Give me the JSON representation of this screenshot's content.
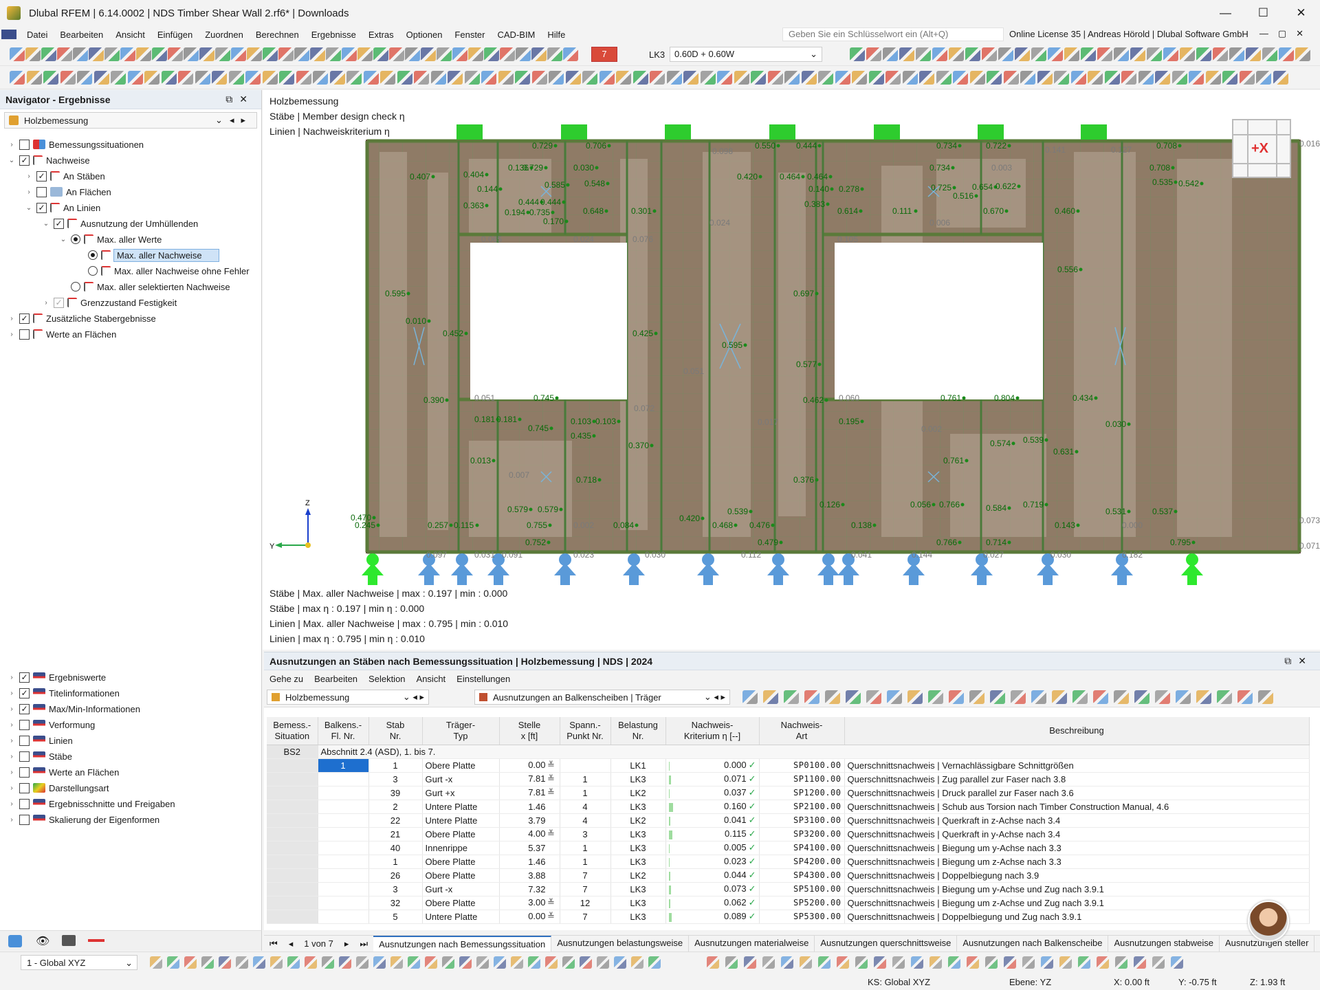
{
  "window": {
    "title": "Dlubal RFEM | 6.14.0002 | NDS Timber Shear Wall 2.rf6* | Downloads",
    "controls": [
      "—",
      "☐",
      "✕"
    ]
  },
  "menu": {
    "items": [
      "Datei",
      "Bearbeiten",
      "Ansicht",
      "Einfügen",
      "Zuordnen",
      "Berechnen",
      "Ergebnisse",
      "Extras",
      "Optionen",
      "Fenster",
      "CAD-BIM",
      "Hilfe"
    ],
    "search_placeholder": "Geben Sie ein Schlüsselwort ein (Alt+Q)",
    "license": "Online License 35 | Andreas Hörold | Dlubal Software GmbH"
  },
  "toolbar": {
    "lc_number": "7",
    "lc_name": "LK3",
    "lc_combo": "0.60D + 0.60W"
  },
  "navigator": {
    "title": "Navigator - Ergebnisse",
    "combo": "Holzbemessung",
    "tree": [
      {
        "label": "Bemessungssituationen",
        "level": 0,
        "exp": ">",
        "check": "empty"
      },
      {
        "label": "Nachweise",
        "level": 0,
        "exp": "v",
        "check": "checked"
      },
      {
        "label": "An Stäben",
        "level": 1,
        "exp": ">",
        "check": "checked"
      },
      {
        "label": "An Flächen",
        "level": 1,
        "exp": ">",
        "check": "empty"
      },
      {
        "label": "An Linien",
        "level": 1,
        "exp": "v",
        "check": "checked"
      },
      {
        "label": "Ausnutzung der Umhüllenden",
        "level": 2,
        "exp": "v",
        "check": "checked"
      },
      {
        "label": "Max. aller Werte",
        "level": 3,
        "exp": "v",
        "check": "radio-on"
      },
      {
        "label": "Max. aller Nachweise",
        "level": 4,
        "exp": "",
        "check": "radio-on",
        "selected": true
      },
      {
        "label": "Max. aller Nachweise ohne Fehler",
        "level": 4,
        "exp": "",
        "check": "radio"
      },
      {
        "label": "Max. aller selektierten Nachweise",
        "level": 3,
        "exp": "",
        "check": "radio"
      },
      {
        "label": "Grenzzustand Festigkeit",
        "level": 2,
        "exp": ">",
        "check": "grey"
      },
      {
        "label": "Zusätzliche Stabergebnisse",
        "level": 0,
        "exp": ">",
        "check": "checked"
      },
      {
        "label": "Werte an Flächen",
        "level": 0,
        "exp": ">",
        "check": "empty"
      }
    ],
    "tree2": [
      {
        "label": "Ergebniswerte",
        "check": "checked"
      },
      {
        "label": "Titelinformationen",
        "check": "checked"
      },
      {
        "label": "Max/Min-Informationen",
        "check": "checked"
      },
      {
        "label": "Verformung",
        "check": "empty"
      },
      {
        "label": "Linien",
        "check": "empty"
      },
      {
        "label": "Stäbe",
        "check": "empty"
      },
      {
        "label": "Werte an Flächen",
        "check": "empty"
      },
      {
        "label": "Darstellungsart",
        "check": "empty"
      },
      {
        "label": "Ergebnisschnitte und Freigaben",
        "check": "empty"
      },
      {
        "label": "Skalierung der Eigenformen",
        "check": "empty"
      }
    ]
  },
  "viewport": {
    "info": [
      "Holzbemessung",
      "Stäbe | Member design check η",
      "Linien | Nachweiskriterium η"
    ],
    "stats": [
      "Stäbe | Max. aller Nachweise | max  : 0.197 | min  : 0.000",
      "Stäbe | max η : 0.197 | min η : 0.000",
      "Linien | Max. aller Nachweise | max  : 0.795 | min  : 0.010",
      "Linien | max η : 0.795 | min η : 0.010"
    ],
    "cube_label": "+X",
    "axis": {
      "z": "Z",
      "y": "Y"
    },
    "labels_green": [
      "0.407",
      "0.404",
      "0.144",
      "0.363",
      "0.136",
      "0.729",
      "0.030",
      "0.585",
      "0.548",
      "0.444",
      "0.444",
      "0.194",
      "0.735",
      "0.170",
      "0.648",
      "0.301",
      "0.420",
      "0.464",
      "0.464",
      "0.140",
      "0.383",
      "0.278",
      "0.614",
      "0.734",
      "0.725",
      "0.516",
      "0.654",
      "0.622",
      "0.111",
      "0.670",
      "0.460",
      "0.708",
      "0.535",
      "0.542",
      "0.595",
      "0.010",
      "0.452",
      "0.425",
      "0.697",
      "0.556",
      "0.595",
      "0.577",
      "0.390",
      "0.181",
      "0.181",
      "0.103",
      "0.103",
      "0.745",
      "0.435",
      "0.370",
      "0.462",
      "0.195",
      "0.761",
      "0.574",
      "0.539",
      "0.631",
      "0.030",
      "0.013",
      "0.718",
      "0.376",
      "0.579",
      "0.579",
      "0.755",
      "0.420",
      "0.539",
      "0.468",
      "0.476",
      "0.126",
      "0.056",
      "0.766",
      "0.584",
      "0.719",
      "0.531",
      "0.537",
      "0.470",
      "0.245",
      "0.257",
      "0.115",
      "0.084",
      "0.138",
      "0.143",
      "0.729",
      "0.706",
      "0.550",
      "0.444",
      "0.734",
      "0.722",
      "0.708",
      "0.752",
      "0.479",
      "0.766",
      "0.714",
      "0.795",
      "0.745",
      "0.761",
      "0.804",
      "0.434"
    ],
    "labels_grey": [
      "0.016",
      "0.073",
      "0.071",
      "0.097",
      "0.031",
      "0.091",
      "0.023",
      "0.030",
      "0.112",
      "0.041",
      "0.144",
      "0.027",
      "0.030",
      "0.182",
      "0.065",
      "0.024",
      "0.076",
      "0.105",
      "0.024",
      "0.051",
      "0.051",
      "0.060",
      "0.072",
      "0.017",
      "0.002",
      "0.007",
      "0.002",
      "0.000",
      "0.006",
      "0.003",
      "0.141",
      "0.127",
      "0.098"
    ]
  },
  "table": {
    "title": "Ausnutzungen an Stäben nach Bemessungssituation | Holzbemessung | NDS | 2024",
    "menu": [
      "Gehe zu",
      "Bearbeiten",
      "Selektion",
      "Ansicht",
      "Einstellungen"
    ],
    "combo1": "Holzbemessung",
    "combo2": "Ausnutzungen an Balkenscheiben | Träger",
    "headers": [
      [
        "Bemess.-",
        "Situation"
      ],
      [
        "Balkens.-",
        "Fl. Nr."
      ],
      [
        "Stab",
        "Nr."
      ],
      [
        "Träger-",
        "Typ"
      ],
      [
        "Stelle",
        "x [ft]"
      ],
      [
        "Spann.-",
        "Punkt Nr."
      ],
      [
        "Belastung",
        "Nr."
      ],
      [
        "Nachweis-",
        "Kriterium η [--]"
      ],
      [
        "Nachweis-",
        "Art"
      ],
      [
        "",
        "Beschreibung"
      ]
    ],
    "group_situation": "BS2",
    "group_label": "Abschnitt 2.4 (ASD), 1. bis 7.",
    "rows": [
      {
        "fl": "1",
        "stab": "1",
        "typ": "Obere Platte",
        "x": "0.00",
        "mark": "≚",
        "sp": "",
        "lk": "LK1",
        "eta": "0.000",
        "art": "SP0100.00",
        "desc": "Querschnittsnachweis | Vernachlässigbare Schnittgrößen"
      },
      {
        "fl": "",
        "stab": "3",
        "typ": "Gurt -x",
        "x": "7.81",
        "mark": "≚",
        "sp": "1",
        "lk": "LK3",
        "eta": "0.071",
        "art": "SP1100.00",
        "desc": "Querschnittsnachweis | Zug parallel zur Faser nach 3.8"
      },
      {
        "fl": "",
        "stab": "39",
        "typ": "Gurt +x",
        "x": "7.81",
        "mark": "≚",
        "sp": "1",
        "lk": "LK2",
        "eta": "0.037",
        "art": "SP1200.00",
        "desc": "Querschnittsnachweis | Druck parallel zur Faser nach 3.6"
      },
      {
        "fl": "",
        "stab": "2",
        "typ": "Untere Platte",
        "x": "1.46",
        "mark": "",
        "sp": "4",
        "lk": "LK3",
        "eta": "0.160",
        "art": "SP2100.00",
        "desc": "Querschnittsnachweis | Schub aus Torsion nach Timber Construction Manual, 4.6"
      },
      {
        "fl": "",
        "stab": "22",
        "typ": "Untere Platte",
        "x": "3.79",
        "mark": "",
        "sp": "4",
        "lk": "LK2",
        "eta": "0.041",
        "art": "SP3100.00",
        "desc": "Querschnittsnachweis | Querkraft in z-Achse nach 3.4"
      },
      {
        "fl": "",
        "stab": "21",
        "typ": "Obere Platte",
        "x": "4.00",
        "mark": "≚",
        "sp": "3",
        "lk": "LK3",
        "eta": "0.115",
        "art": "SP3200.00",
        "desc": "Querschnittsnachweis | Querkraft in y-Achse nach 3.4"
      },
      {
        "fl": "",
        "stab": "40",
        "typ": "Innenrippe",
        "x": "5.37",
        "mark": "",
        "sp": "1",
        "lk": "LK3",
        "eta": "0.005",
        "art": "SP4100.00",
        "desc": "Querschnittsnachweis | Biegung um y-Achse nach 3.3"
      },
      {
        "fl": "",
        "stab": "1",
        "typ": "Obere Platte",
        "x": "1.46",
        "mark": "",
        "sp": "1",
        "lk": "LK3",
        "eta": "0.023",
        "art": "SP4200.00",
        "desc": "Querschnittsnachweis | Biegung um z-Achse nach 3.3"
      },
      {
        "fl": "",
        "stab": "26",
        "typ": "Obere Platte",
        "x": "3.88",
        "mark": "",
        "sp": "7",
        "lk": "LK2",
        "eta": "0.044",
        "art": "SP4300.00",
        "desc": "Querschnittsnachweis | Doppelbiegung nach 3.9"
      },
      {
        "fl": "",
        "stab": "3",
        "typ": "Gurt -x",
        "x": "7.32",
        "mark": "",
        "sp": "7",
        "lk": "LK3",
        "eta": "0.073",
        "art": "SP5100.00",
        "desc": "Querschnittsnachweis | Biegung um y-Achse und Zug nach 3.9.1"
      },
      {
        "fl": "",
        "stab": "32",
        "typ": "Obere Platte",
        "x": "3.00",
        "mark": "≚",
        "sp": "12",
        "lk": "LK3",
        "eta": "0.062",
        "art": "SP5200.00",
        "desc": "Querschnittsnachweis | Biegung um z-Achse und Zug nach 3.9.1"
      },
      {
        "fl": "",
        "stab": "5",
        "typ": "Untere Platte",
        "x": "0.00",
        "mark": "≚",
        "sp": "7",
        "lk": "LK3",
        "eta": "0.089",
        "art": "SP5300.00",
        "desc": "Querschnittsnachweis | Doppelbiegung und Zug nach 3.9.1"
      }
    ]
  },
  "tabs": {
    "page": "1 von 7",
    "items": [
      "Ausnutzungen nach Bemessungssituation",
      "Ausnutzungen belastungsweise",
      "Ausnutzungen materialweise",
      "Ausnutzungen querschnittsweise",
      "Ausnutzungen nach Balkenscheibe",
      "Ausnutzungen stabweise",
      "Ausnutzungen steller"
    ]
  },
  "status": {
    "cs": "1 - Global XYZ",
    "ks": "KS: Global XYZ",
    "ebene": "Ebene: YZ",
    "x": "X: 0.00 ft",
    "y": "Y: -0.75 ft",
    "z": "Z: 1.93 ft"
  },
  "colors": {
    "accent": "#2f6fbf",
    "ok": "#2aa84a",
    "support": "#2ee82e",
    "hinge": "#4a90d9",
    "wall": "#8f7b66"
  }
}
